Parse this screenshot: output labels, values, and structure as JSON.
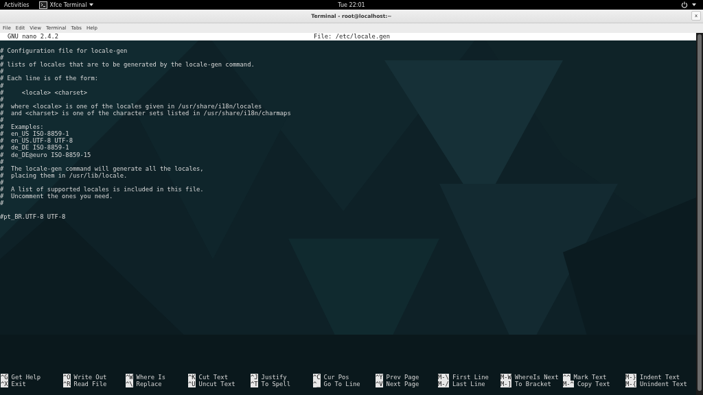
{
  "top_bar": {
    "activities": "Activities",
    "app_menu": "Xfce Terminal",
    "clock": "Tue 22:01"
  },
  "window": {
    "title": "Terminal - root@localhost:~",
    "close": "x"
  },
  "menu": [
    "File",
    "Edit",
    "View",
    "Terminal",
    "Tabs",
    "Help"
  ],
  "nano": {
    "version": "GNU nano 2.4.2",
    "file": "File: /etc/locale.gen",
    "lines": [
      "# Configuration file for locale-gen",
      "#",
      "# lists of locales that are to be generated by the locale-gen command.",
      "#",
      "# Each line is of the form:",
      "#",
      "#     <locale> <charset>",
      "#",
      "#  where <locale> is one of the locales given in /usr/share/i18n/locales",
      "#  and <charset> is one of the character sets listed in /usr/share/i18n/charmaps",
      "#",
      "#  Examples:",
      "#  en_US ISO-8859-1",
      "#  en_US.UTF-8 UTF-8",
      "#  de_DE ISO-8859-1",
      "#  de_DE@euro ISO-8859-15",
      "#",
      "#  The locale-gen command will generate all the locales,",
      "#  placing them in /usr/lib/locale.",
      "#",
      "#  A list of supported locales is included in this file.",
      "#  Uncomment the ones you need.",
      "#",
      {
        "kind": "blank"
      },
      "#pt_BR.UTF-8 UTF-8"
    ],
    "shortcuts": [
      {
        "key": "^G",
        "label": "Get Help"
      },
      {
        "key": "^X",
        "label": "Exit"
      },
      {
        "key": "^O",
        "label": "Write Out"
      },
      {
        "key": "^R",
        "label": "Read File"
      },
      {
        "key": "^W",
        "label": "Where Is"
      },
      {
        "key": "^\\",
        "label": "Replace"
      },
      {
        "key": "^K",
        "label": "Cut Text"
      },
      {
        "key": "^U",
        "label": "Uncut Text"
      },
      {
        "key": "^J",
        "label": "Justify"
      },
      {
        "key": "^T",
        "label": "To Spell"
      },
      {
        "key": "^C",
        "label": "Cur Pos"
      },
      {
        "key": "^_",
        "label": "Go To Line"
      },
      {
        "key": "^Y",
        "label": "Prev Page"
      },
      {
        "key": "^V",
        "label": "Next Page"
      },
      {
        "key": "M-\\",
        "label": "First Line"
      },
      {
        "key": "M-/",
        "label": "Last Line"
      },
      {
        "key": "M-W",
        "label": "WhereIs Next"
      },
      {
        "key": "M-]",
        "label": "To Bracket"
      },
      {
        "key": "^^",
        "label": "Mark Text"
      },
      {
        "key": "M-^",
        "label": "Copy Text"
      },
      {
        "key": "M-}",
        "label": "Indent Text"
      },
      {
        "key": "M-{",
        "label": "Unindent Text"
      }
    ]
  }
}
